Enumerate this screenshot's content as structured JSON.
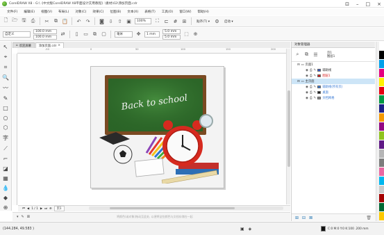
{
  "window": {
    "title": "CorelDRAW X8 - G:\\《中文版CorelDRAW X8平面设计实用教程》\\素材\\02\\添加页面.cdr",
    "controls": [
      "⊡",
      "–",
      "□",
      "×"
    ]
  },
  "menu": [
    "文件(F)",
    "编辑(E)",
    "视图(V)",
    "布局(L)",
    "对象(C)",
    "效果(C)",
    "位图(B)",
    "文本(X)",
    "表格(T)",
    "工具(O)",
    "窗口(W)",
    "帮助(H)"
  ],
  "toolbar": {
    "zoom": "100%",
    "snap_label": "贴齐(T) ▾",
    "launch_label": "启动 ▾"
  },
  "propbar": {
    "page_size_select": "自定义",
    "width": "100.0 mm",
    "height": "100.0 mm",
    "units": "毫米",
    "nudge": "1 mm",
    "dup_x": "5.0 mm",
    "dup_y": "5.0 mm"
  },
  "doc_tabs": [
    {
      "label": "欢迎屏幕",
      "active": false
    },
    {
      "label": "添加页面.cdr",
      "active": true
    }
  ],
  "ruler": {
    "ticks": [
      "-50",
      "0",
      "50",
      "100",
      "150",
      "200"
    ]
  },
  "artwork": {
    "chalk_text": "Back to school",
    "palette_colors": {
      "board": "#2e6b2a",
      "frame": "#7a4a22",
      "clock": "#d62a1f"
    }
  },
  "page_nav": {
    "counter": "1 / 1",
    "page_tab": "页1"
  },
  "canvas_hint": "将颜色(或对象)拖动至此处, 以便将这些颜色与文档存储在一起",
  "docker": {
    "title": "对象管理器",
    "page_info": [
      "页1",
      "图层1"
    ],
    "rows": [
      {
        "indent": 0,
        "label": "页面1",
        "kind": "page",
        "selected": false,
        "color": "#333333",
        "swatch": ""
      },
      {
        "indent": 1,
        "label": "辅助线",
        "kind": "layer",
        "selected": false,
        "color": "#333333",
        "swatch": "#3355cc"
      },
      {
        "indent": 1,
        "label": "图层1",
        "kind": "layer",
        "selected": false,
        "color": "#d62020",
        "swatch": "#d62020"
      },
      {
        "indent": 0,
        "label": "主页面",
        "kind": "page",
        "selected": true,
        "color": "#333333",
        "swatch": ""
      },
      {
        "indent": 1,
        "label": "辅助线(所有页)",
        "kind": "layer",
        "selected": false,
        "color": "#3a7bd5",
        "swatch": "#3a7bd5"
      },
      {
        "indent": 1,
        "label": "桌面",
        "kind": "layer",
        "selected": false,
        "color": "#3a7bd5",
        "swatch": "#222222"
      },
      {
        "indent": 1,
        "label": "文档网格",
        "kind": "layer",
        "selected": false,
        "color": "#3a7bd5",
        "swatch": "#888888"
      }
    ]
  },
  "palette": [
    "#ffffff",
    "#000000",
    "#00a0e9",
    "#e4007f",
    "#fff100",
    "#e60012",
    "#009944",
    "#1d2088",
    "#f39800",
    "#920783",
    "#8fc31f",
    "#601986",
    "#b5b5b6",
    "#7d7d7d",
    "#ea68a2",
    "#00b7ee",
    "#c9caca",
    "#a40000",
    "#006934",
    "#fcc800"
  ],
  "status": {
    "coords": "(144.284, 49.583 )",
    "color_info": "C:0 M:0 Y:0 K:100  .200 mm"
  }
}
